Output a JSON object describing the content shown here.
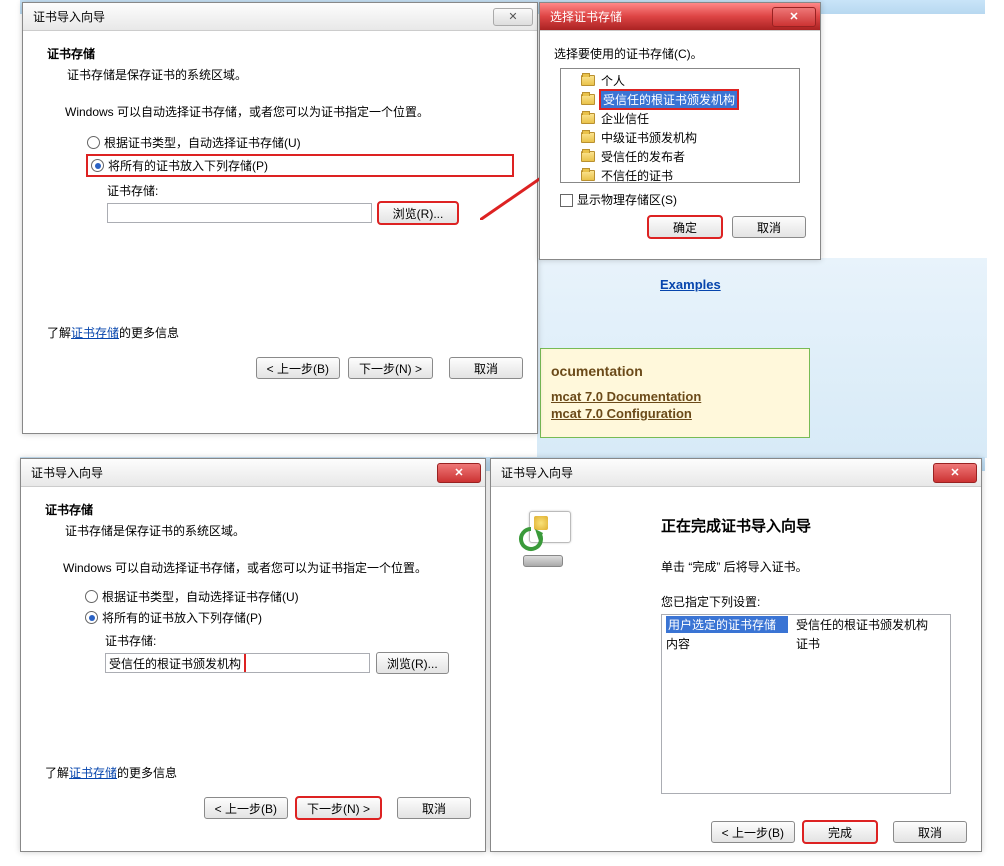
{
  "wizard1": {
    "title": "证书导入向导",
    "close": "✕",
    "section_title": "证书存储",
    "section_sub": "证书存储是保存证书的系统区域。",
    "autotext": "Windows 可以自动选择证书存储，或者您可以为证书指定一个位置。",
    "radio_auto": "根据证书类型，自动选择证书存储(U)",
    "radio_manual": "将所有的证书放入下列存储(P)",
    "store_label": "证书存储:",
    "store_value": "",
    "browse": "浏览(R)...",
    "learn_pre": "了解",
    "learn_link": "证书存储",
    "learn_post": "的更多信息",
    "back": "< 上一步(B)",
    "next": "下一步(N) >",
    "cancel": "取消"
  },
  "storeDialog": {
    "title": "选择证书存储",
    "instruction": "选择要使用的证书存储(C)。",
    "items": {
      "personal": "个人",
      "trusted_root": "受信任的根证书颁发机构",
      "enterprise": "企业信任",
      "intermediate": "中级证书颁发机构",
      "trusted_pub": "受信任的发布者",
      "untrusted": "不信任的证书"
    },
    "show_physical": "显示物理存储区(S)",
    "ok": "确定",
    "cancel": "取消"
  },
  "backExamples": "Examples",
  "docCard": {
    "hdr": "ocumentation",
    "link1": "mcat 7.0 Documentation",
    "link2": "mcat 7.0 Configuration"
  },
  "wizard2": {
    "title": "证书导入向导",
    "section_title": "证书存储",
    "section_sub": "证书存储是保存证书的系统区域。",
    "autotext": "Windows 可以自动选择证书存储，或者您可以为证书指定一个位置。",
    "radio_auto": "根据证书类型，自动选择证书存储(U)",
    "radio_manual": "将所有的证书放入下列存储(P)",
    "store_label": "证书存储:",
    "store_value": "受信任的根证书颁发机构",
    "browse": "浏览(R)...",
    "learn_pre": "了解",
    "learn_link": "证书存储",
    "learn_post": "的更多信息",
    "back": "< 上一步(B)",
    "next": "下一步(N) >",
    "cancel": "取消"
  },
  "wizard3": {
    "title": "证书导入向导",
    "heading": "正在完成证书导入向导",
    "instruction": "单击 “完成” 后将导入证书。",
    "settings_label": "您已指定下列设置:",
    "row1_key": "用户选定的证书存储",
    "row1_val": "受信任的根证书颁发机构",
    "row2_key": "内容",
    "row2_val": "证书",
    "back": "< 上一步(B)",
    "finish": "完成",
    "cancel": "取消"
  }
}
